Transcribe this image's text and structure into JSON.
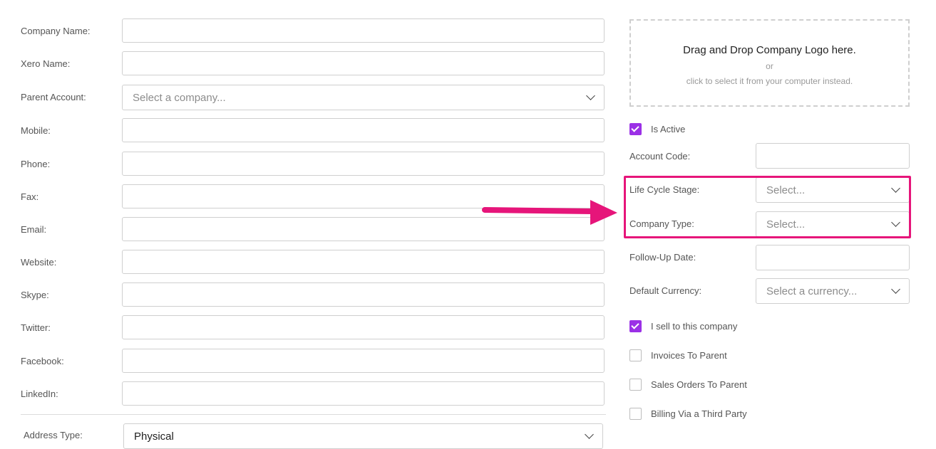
{
  "left_form": {
    "fields": [
      {
        "label": "Company Name:",
        "value": ""
      },
      {
        "label": "Xero Name:",
        "value": ""
      },
      {
        "label": "Parent Account:",
        "placeholder": "Select a company..."
      },
      {
        "label": "Mobile:",
        "value": ""
      },
      {
        "label": "Phone:",
        "value": ""
      },
      {
        "label": "Fax:",
        "value": ""
      },
      {
        "label": "Email:",
        "value": ""
      },
      {
        "label": "Website:",
        "value": ""
      },
      {
        "label": "Skype:",
        "value": ""
      },
      {
        "label": "Twitter:",
        "value": ""
      },
      {
        "label": "Facebook:",
        "value": ""
      },
      {
        "label": "LinkedIn:",
        "value": ""
      }
    ],
    "address_type": {
      "label": "Address Type:",
      "value": "Physical"
    }
  },
  "logo_dropzone": {
    "title": "Drag and Drop Company Logo here.",
    "or": "or",
    "subtitle": "click to select it from your computer instead."
  },
  "right_form": {
    "is_active": {
      "label": "Is Active",
      "checked": true
    },
    "account_code": {
      "label": "Account Code:",
      "value": ""
    },
    "life_cycle_stage": {
      "label": "Life Cycle Stage:",
      "placeholder": "Select..."
    },
    "company_type": {
      "label": "Company Type:",
      "placeholder": "Select..."
    },
    "follow_up_date": {
      "label": "Follow-Up Date:",
      "value": ""
    },
    "default_currency": {
      "label": "Default Currency:",
      "placeholder": "Select a currency..."
    },
    "checkboxes": [
      {
        "label": "I sell to this company",
        "checked": true
      },
      {
        "label": "Invoices To Parent",
        "checked": false
      },
      {
        "label": "Sales Orders To Parent",
        "checked": false
      },
      {
        "label": "Billing Via a Third Party",
        "checked": false
      }
    ]
  },
  "colors": {
    "accent": "#9b30e6",
    "annotation": "#e6157a"
  }
}
